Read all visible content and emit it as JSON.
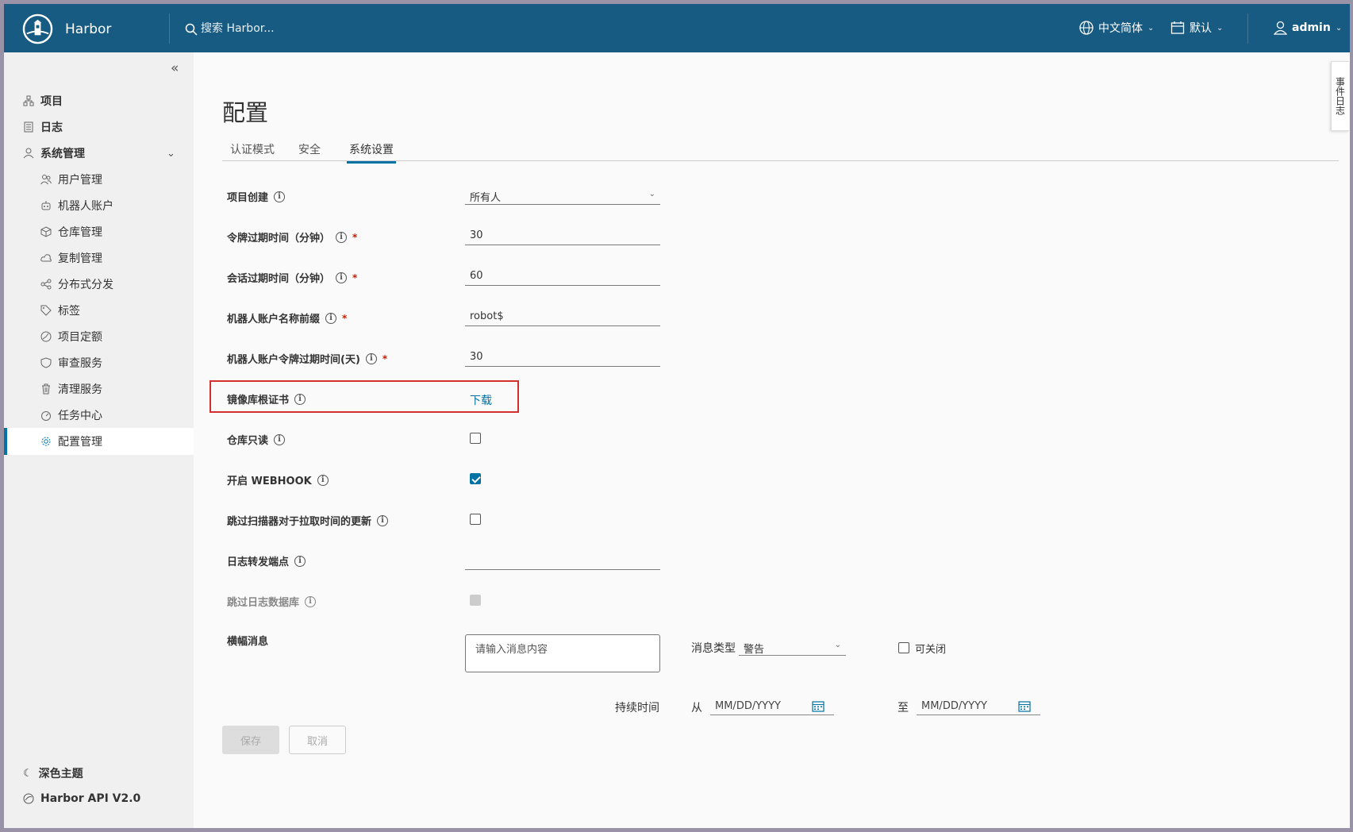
{
  "header": {
    "brand": "Harbor",
    "search_placeholder": "搜索 Harbor...",
    "language": "中文简体",
    "schedule": "默认",
    "user": "admin"
  },
  "sidebar": {
    "items": [
      {
        "label": "项目",
        "icon": "projects-icon"
      },
      {
        "label": "日志",
        "icon": "logs-icon"
      },
      {
        "label": "系统管理",
        "icon": "system-admin-icon"
      },
      {
        "label": "用户管理",
        "icon": "users-icon"
      },
      {
        "label": "机器人账户",
        "icon": "robot-icon"
      },
      {
        "label": "仓库管理",
        "icon": "registry-icon"
      },
      {
        "label": "复制管理",
        "icon": "replication-icon"
      },
      {
        "label": "分布式分发",
        "icon": "distribution-icon"
      },
      {
        "label": "标签",
        "icon": "tag-icon"
      },
      {
        "label": "项目定额",
        "icon": "quota-icon"
      },
      {
        "label": "审查服务",
        "icon": "shield-icon"
      },
      {
        "label": "清理服务",
        "icon": "trash-icon"
      },
      {
        "label": "任务中心",
        "icon": "dashboard-icon"
      },
      {
        "label": "配置管理",
        "icon": "gear-icon"
      }
    ],
    "dark_theme": "深色主题",
    "api": "Harbor API V2.0"
  },
  "page": {
    "title": "配置",
    "tabs": [
      "认证模式",
      "安全",
      "系统设置"
    ],
    "active_tab": "系统设置"
  },
  "form": {
    "project_creation": {
      "label": "项目创建",
      "value": "所有人"
    },
    "token_expiry": {
      "label": "令牌过期时间（分钟）",
      "value": "30"
    },
    "session_expiry": {
      "label": "会话过期时间（分钟）",
      "value": "60"
    },
    "robot_prefix": {
      "label": "机器人账户名称前缀",
      "value": "robot$"
    },
    "robot_token_expiry": {
      "label": "机器人账户令牌过期时间(天)",
      "value": "30"
    },
    "root_cert": {
      "label": "镜像库根证书",
      "link": "下载"
    },
    "readonly": {
      "label": "仓库只读",
      "checked": false
    },
    "webhook": {
      "label": "开启 WEBHOOK",
      "checked": true
    },
    "skip_scanner": {
      "label": "跳过扫描器对于拉取时间的更新",
      "checked": false
    },
    "log_endpoint": {
      "label": "日志转发端点",
      "value": ""
    },
    "skip_log_db": {
      "label": "跳过日志数据库",
      "checked": false,
      "disabled": true
    },
    "banner": {
      "label": "横幅消息",
      "placeholder": "请输入消息内容",
      "type_label": "消息类型",
      "type_value": "警告",
      "closable_label": "可关闭",
      "duration_label": "持续时间",
      "from_label": "从",
      "to_label": "至",
      "date_placeholder": "MM/DD/YYYY"
    }
  },
  "buttons": {
    "save": "保存",
    "cancel": "取消"
  },
  "event_log": "事件日志",
  "colors": {
    "header": "#175b82",
    "accent": "#0072a3",
    "highlight": "#d32f2f"
  }
}
